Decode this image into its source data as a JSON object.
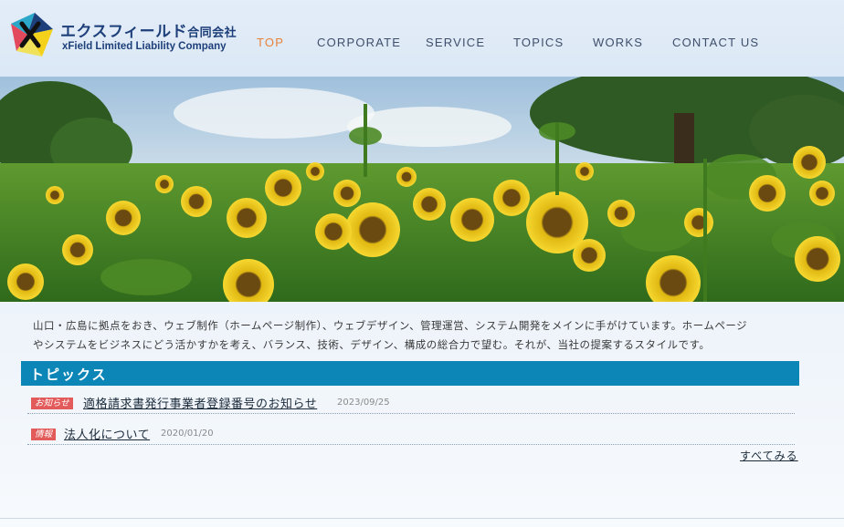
{
  "header": {
    "logo_jp": "エクスフィールド",
    "logo_jp_suffix": "合同会社",
    "logo_en": "xField Limited Liability Company",
    "nav": [
      {
        "label": "TOP",
        "active": true
      },
      {
        "label": "CORPORATE"
      },
      {
        "label": "SERVICE"
      },
      {
        "label": "TOPICS"
      },
      {
        "label": "WORKS"
      },
      {
        "label": "CONTACT US"
      }
    ]
  },
  "intro": {
    "line1": "山口・広島に拠点をおき、ウェブ制作（ホームページ制作）、ウェブデザイン、管理運営、システム開発をメインに手がけています。ホームページ",
    "line2": "やシステムをビジネスにどう活かすかを考え、バランス、技術、デザイン、構成の総合力で望む。それが、当社の提案するスタイルです。"
  },
  "topics": {
    "heading": "トピックス",
    "items": [
      {
        "badge": "お知らせ",
        "title": "適格請求書発行事業者登録番号のお知らせ",
        "date": "2023/09/25"
      },
      {
        "badge": "情報",
        "title": "法人化について",
        "date": "2020/01/20"
      }
    ],
    "see_all": "すべてみる"
  },
  "colors": {
    "accent_nav": "#e8813a",
    "topics_bar": "#0b86b7",
    "badge": "#e25a5a",
    "logo_text": "#1d3f7a"
  }
}
